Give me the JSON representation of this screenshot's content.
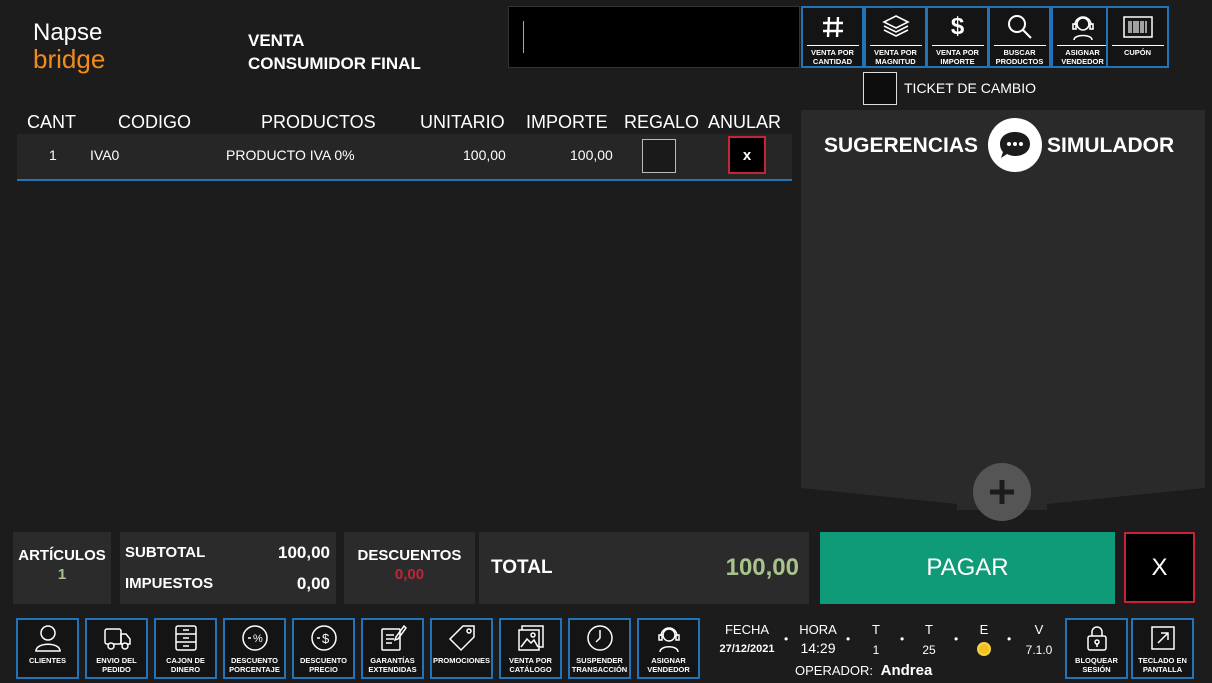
{
  "logo": {
    "line1": "Napse",
    "line2": "bridge"
  },
  "sale": {
    "line1": "VENTA",
    "line2": "CONSUMIDOR FINAL"
  },
  "toolbar": [
    {
      "label": "VENTA POR CANTIDAD",
      "icon": "hash-icon"
    },
    {
      "label": "VENTA POR MAGNITUD",
      "icon": "layers-icon"
    },
    {
      "label": "VENTA POR IMPORTE",
      "icon": "dollar-icon"
    },
    {
      "label": "BUSCAR PRODUCTOS",
      "icon": "search-icon"
    },
    {
      "label": "ASIGNAR VENDEDOR",
      "icon": "headset-icon"
    },
    {
      "label": "CUPÓN",
      "icon": "barcode-icon"
    }
  ],
  "ticket_change": "TICKET DE CAMBIO",
  "table": {
    "headers": [
      "CANT",
      "CODIGO",
      "PRODUCTOS",
      "UNITARIO",
      "IMPORTE",
      "REGALO",
      "ANULAR"
    ],
    "rows": [
      {
        "cant": "1",
        "codigo": "IVA0",
        "producto": "PRODUCTO IVA 0%",
        "unitario": "100,00",
        "importe": "100,00",
        "anular": "x"
      }
    ]
  },
  "panel": {
    "left": "SUGERENCIAS",
    "right": "SIMULADOR"
  },
  "totals": {
    "articulos_label": "ARTÍCULOS",
    "articulos_value": "1",
    "subtotal_label": "SUBTOTAL",
    "subtotal_value": "100,00",
    "impuestos_label": "IMPUESTOS",
    "impuestos_value": "0,00",
    "descuentos_label": "DESCUENTOS",
    "descuentos_value": "0,00",
    "total_label": "TOTAL",
    "total_value": "100,00"
  },
  "pay_label": "PAGAR",
  "cancel_label": "X",
  "bottom_toolbar": [
    {
      "l1": "CLIENTES",
      "l2": "",
      "icon": "user-icon"
    },
    {
      "l1": "ENVIO DEL",
      "l2": "PEDIDO",
      "icon": "delivery-truck-icon"
    },
    {
      "l1": "CAJON DE",
      "l2": "DINERO",
      "icon": "cash-drawer-icon"
    },
    {
      "l1": "DESCUENTO",
      "l2": "PORCENTAJE",
      "icon": "percent-discount-icon"
    },
    {
      "l1": "DESCUENTO",
      "l2": "PRECIO",
      "icon": "price-discount-icon"
    },
    {
      "l1": "GARANTÍAS",
      "l2": "EXTENDIDAS",
      "icon": "warranty-icon"
    },
    {
      "l1": "PROMOCIONES",
      "l2": "",
      "icon": "tag-icon"
    },
    {
      "l1": "VENTA POR",
      "l2": "CATÁLOGO",
      "icon": "catalog-icon"
    },
    {
      "l1": "SUSPENDER",
      "l2": "TRANSACCIÓN",
      "icon": "clock-icon"
    },
    {
      "l1": "ASIGNAR",
      "l2": "VENDEDOR",
      "icon": "headset-icon"
    }
  ],
  "status": {
    "fecha_label": "FECHA",
    "fecha_value": "27/12/2021",
    "hora_label": "HORA",
    "hora_value": "14:29",
    "t1_label": "T",
    "t1_value": "1",
    "t2_label": "T",
    "t2_value": "25",
    "e_label": "E",
    "v_label": "V",
    "v_value": "7.1.0",
    "operador_label": "OPERADOR:",
    "operador_value": "Andrea"
  },
  "right_buttons": [
    {
      "l1": "BLOQUEAR",
      "l2": "SESIÓN",
      "icon": "lock-icon"
    },
    {
      "l1": "TECLADO EN",
      "l2": "PANTALLA",
      "icon": "expand-icon"
    }
  ],
  "colors": {
    "accent": "#2373b8",
    "pay": "#0f9a78",
    "danger": "#c4243a",
    "logo_orange": "#f28a20",
    "total_green": "#a8c48e",
    "status_dot": "#f2c21b"
  }
}
